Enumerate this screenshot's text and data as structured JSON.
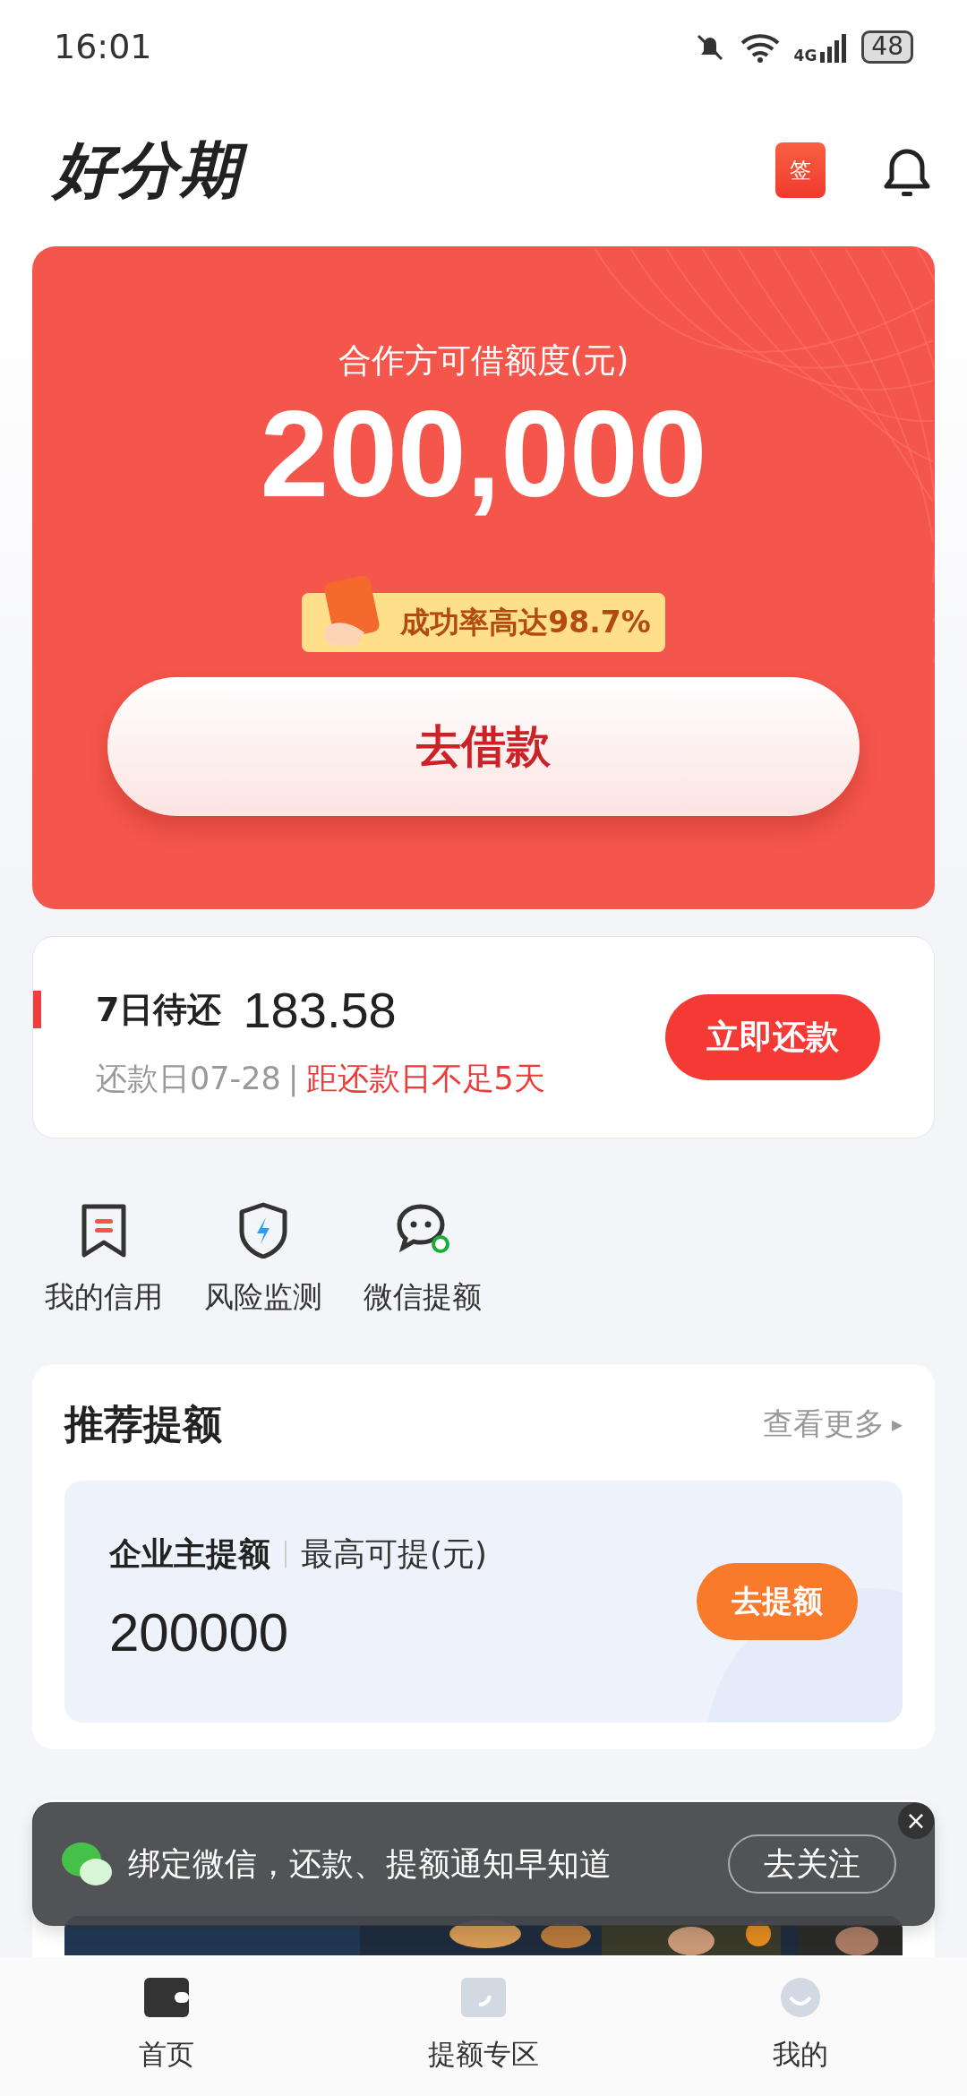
{
  "status_bar": {
    "time": "16:01",
    "network": "4G",
    "battery": "48"
  },
  "header": {
    "logo": "好分期",
    "sign_label": "签"
  },
  "credit_card": {
    "label": "合作方可借额度(元)",
    "amount": "200,000",
    "badge": "成功率高达98.7%",
    "button": "去借款"
  },
  "repayment": {
    "title": "7日待还",
    "amount": "183.58",
    "due": "还款日07-28",
    "separator": "|",
    "warning": "距还款日不足5天",
    "button": "立即还款"
  },
  "shortcuts": [
    {
      "kind": "credit",
      "label": "我的信用"
    },
    {
      "kind": "risk",
      "label": "风险监测"
    },
    {
      "kind": "wechat",
      "label": "微信提额"
    }
  ],
  "recommend": {
    "title": "推荐提额",
    "more": "查看更多",
    "more_arrow": "▸",
    "item": {
      "name": "企业主提额",
      "label": "最高可提(元)",
      "amount": "200000",
      "button": "去提额"
    }
  },
  "toast": {
    "text": "绑定微信，还款、提额通知早知道",
    "button": "去关注",
    "close": "×"
  },
  "bottom_nav": [
    {
      "kind": "home",
      "label": "首页",
      "selected": true
    },
    {
      "kind": "boost",
      "label": "提额专区",
      "selected": false
    },
    {
      "kind": "me",
      "label": "我的",
      "selected": false
    }
  ]
}
